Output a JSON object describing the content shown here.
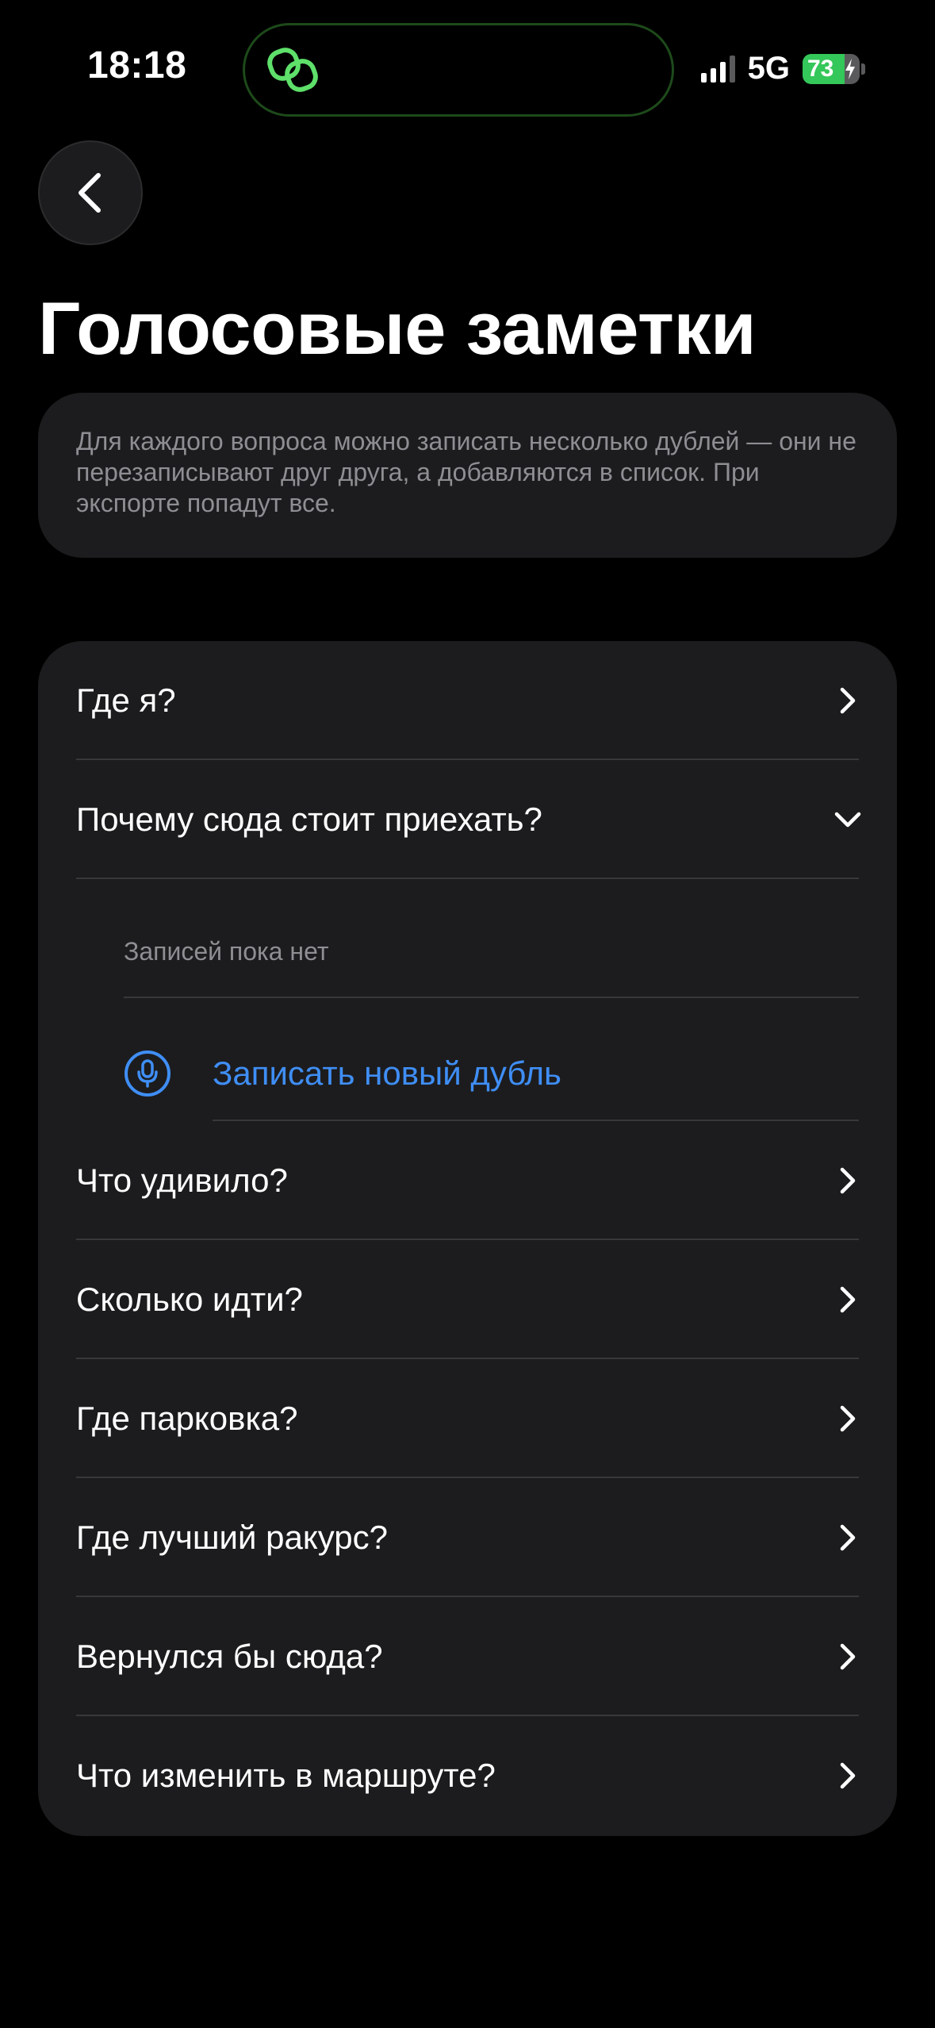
{
  "status_bar": {
    "time": "18:18",
    "network": "5G",
    "battery_percent": "73"
  },
  "colors": {
    "background": "#000000",
    "card": "#1c1c1e",
    "accent_blue": "#3f8ef5",
    "battery_green": "#34c759",
    "island_icon_green": "#5ee06a"
  },
  "header": {
    "back_icon": "chevron-left-icon",
    "title": "Голосовые заметки"
  },
  "info": {
    "text": "Для каждого вопроса можно записать несколько дублей — они не перезаписывают друг друга, а добавляются в список. При экспорте попадут все."
  },
  "questions": [
    {
      "label": "Где я?",
      "expanded": false
    },
    {
      "label": "Почему сюда стоит приехать?",
      "expanded": true,
      "empty_text": "Записей пока нет",
      "record_label": "Записать новый дубль",
      "record_icon": "microphone-icon"
    },
    {
      "label": "Что удивило?",
      "expanded": false
    },
    {
      "label": "Сколько идти?",
      "expanded": false
    },
    {
      "label": "Где парковка?",
      "expanded": false
    },
    {
      "label": "Где лучший ракурс?",
      "expanded": false
    },
    {
      "label": "Вернулся бы сюда?",
      "expanded": false
    },
    {
      "label": "Что изменить в маршруте?",
      "expanded": false
    }
  ]
}
